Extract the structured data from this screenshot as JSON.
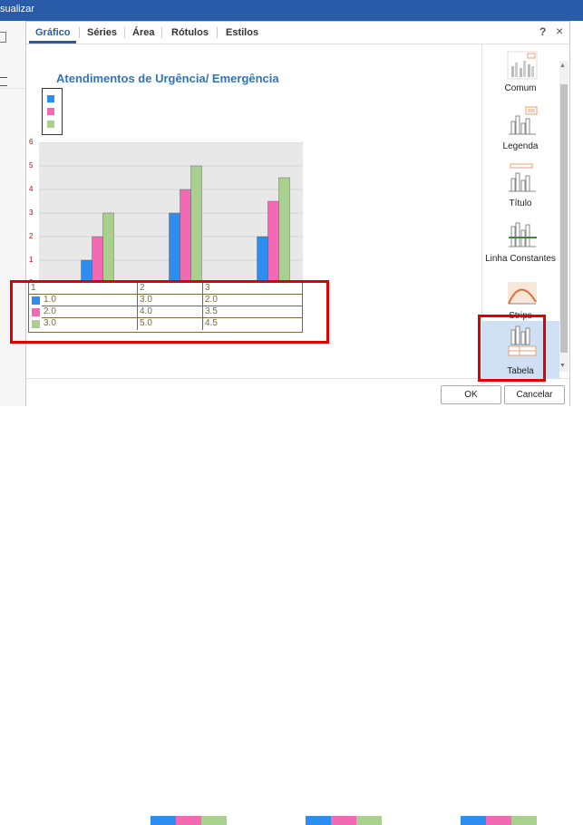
{
  "window": {
    "title_fragment": "sualizar"
  },
  "dialog": {
    "tabs": [
      {
        "label": "Gráfico",
        "active": true
      },
      {
        "label": "Séries"
      },
      {
        "label": "Área"
      },
      {
        "label": "Rótulos"
      },
      {
        "label": "Estilos"
      }
    ],
    "help_label": "?",
    "close_label": "×",
    "ok_label": "OK",
    "cancel_label": "Cancelar"
  },
  "chart_data": {
    "type": "bar",
    "title": "Atendimentos de Urgência/ Emergência",
    "categories": [
      "1",
      "2",
      "3"
    ],
    "series": [
      {
        "values": [
          1.0,
          3.0,
          2.0
        ],
        "color": "#2e8ef0"
      },
      {
        "values": [
          2.0,
          4.0,
          3.5
        ],
        "color": "#f26ab4"
      },
      {
        "values": [
          3.0,
          5.0,
          4.5
        ],
        "color": "#a9d08e"
      }
    ],
    "yticks": [
      "0",
      "1",
      "2",
      "3",
      "4",
      "5",
      "6"
    ],
    "ylim": [
      0,
      6
    ],
    "grid": true,
    "legend": "top-left"
  },
  "data_table": {
    "header": [
      "1",
      "2",
      "3"
    ],
    "rows": [
      [
        "1.0",
        "3.0",
        "2.0"
      ],
      [
        "2.0",
        "4.0",
        "3.5"
      ],
      [
        "3.0",
        "5.0",
        "4.5"
      ]
    ]
  },
  "gallery": [
    {
      "label": "Comum",
      "icon": "chart-common-icon"
    },
    {
      "label": "Legenda",
      "icon": "chart-legend-icon"
    },
    {
      "label": "Título",
      "icon": "chart-title-icon"
    },
    {
      "label": "Linha Constantes",
      "icon": "chart-constant-line-icon"
    },
    {
      "label": "Strips",
      "icon": "chart-strips-icon"
    },
    {
      "label": "Tabela",
      "icon": "chart-table-icon",
      "selected": true
    }
  ],
  "colors": {
    "accent": "#2a5ba8",
    "title": "#3374b5",
    "highlight": "#e00000"
  }
}
